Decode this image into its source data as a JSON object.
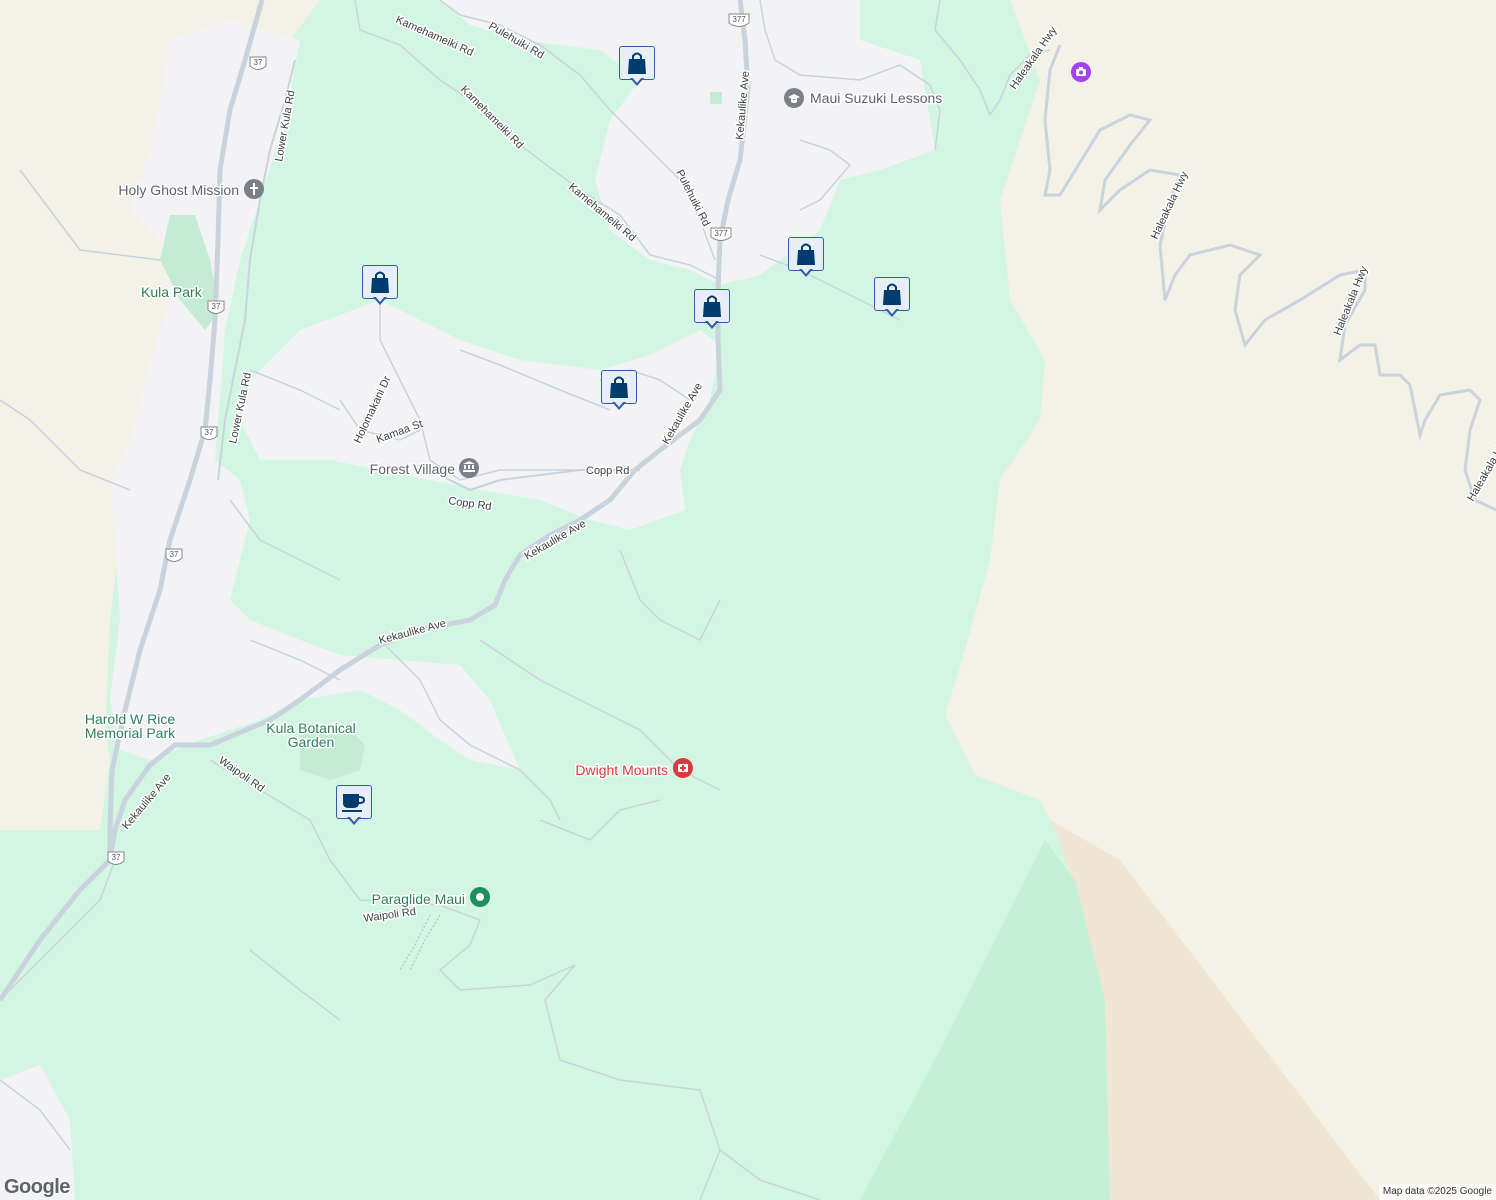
{
  "map": {
    "roads": [
      {
        "name": "Kamehameiki Rd"
      },
      {
        "name": "Kamehameiki Rd"
      },
      {
        "name": "Kamehameiki Rd"
      },
      {
        "name": "Pulehuiki Rd"
      },
      {
        "name": "Pulehuiki Rd"
      },
      {
        "name": "Kekaulike Ave"
      },
      {
        "name": "Kekaulike Ave"
      },
      {
        "name": "Kekaulike Ave"
      },
      {
        "name": "Kekaulike Ave"
      },
      {
        "name": "Kekaulike Ave"
      },
      {
        "name": "Haleakala Hwy"
      },
      {
        "name": "Haleakala Hwy"
      },
      {
        "name": "Haleakala Hwy"
      },
      {
        "name": "Haleakala Hwy"
      },
      {
        "name": "Lower Kula Rd"
      },
      {
        "name": "Lower Kula Rd"
      },
      {
        "name": "Holomakani Dr"
      },
      {
        "name": "Kamaa St"
      },
      {
        "name": "Copp Rd"
      },
      {
        "name": "Copp Rd"
      },
      {
        "name": "Waipoli Rd"
      },
      {
        "name": "Waipoli Rd"
      }
    ],
    "shields": [
      {
        "number": "37"
      },
      {
        "number": "37"
      },
      {
        "number": "37"
      },
      {
        "number": "37"
      },
      {
        "number": "37"
      },
      {
        "number": "377"
      },
      {
        "number": "377"
      }
    ],
    "places": [
      {
        "name": "Maui Suzuki Lessons",
        "icon": "school-icon",
        "color": "#5f6368"
      },
      {
        "name": "Holy Ghost Mission",
        "icon": "church-icon",
        "color": "#5f6368"
      },
      {
        "name": "Kula Park",
        "icon": "",
        "color": "#2e7d5b"
      },
      {
        "name": "Forest Village",
        "icon": "museum-icon",
        "color": "#5f6368"
      },
      {
        "name": "Harold W Rice",
        "icon": "",
        "color": "#2e7d5b"
      },
      {
        "name": "Memorial Park",
        "icon": "",
        "color": "#2e7d5b"
      },
      {
        "name": "Kula Botanical",
        "icon": "",
        "color": "#2e7d5b"
      },
      {
        "name": "Garden",
        "icon": "",
        "color": "#2e7d5b"
      },
      {
        "name": "Dwight Mounts",
        "icon": "hospital-icon",
        "color": "#d93a3f"
      },
      {
        "name": "Paraglide Maui",
        "icon": "activity-icon",
        "color": "#2e7d5b"
      }
    ],
    "markers": [
      {
        "type": "shopping-bag-icon"
      },
      {
        "type": "shopping-bag-icon"
      },
      {
        "type": "shopping-bag-icon"
      },
      {
        "type": "shopping-bag-icon"
      },
      {
        "type": "shopping-bag-icon"
      },
      {
        "type": "shopping-bag-icon"
      },
      {
        "type": "coffee-cup-icon"
      }
    ],
    "viewpoint_icon": "camera-icon",
    "colors": {
      "land": "#f4f1e7",
      "forest": "#d2f6e2",
      "urban": "#f3f3f5",
      "road": "#c9d3dd",
      "marker_fill": "#003c6e",
      "marker_border": "#2f5ea8",
      "hospital": "#d93a3f",
      "viewpoint": "#a142f4"
    }
  },
  "footer": {
    "logo": "Google",
    "attribution": "Map data ©2025 Google"
  }
}
